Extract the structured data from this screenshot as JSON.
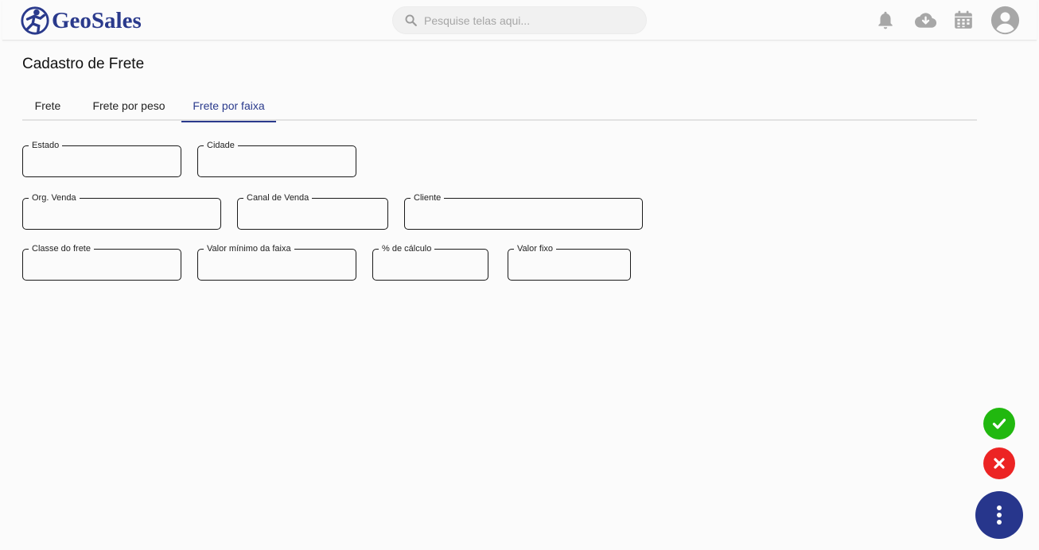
{
  "header": {
    "logo_text": "GeoSales",
    "search_placeholder": "Pesquise telas aqui...",
    "brand_color": "#2a3a8c",
    "icons": [
      "bell-icon",
      "cloud-download-icon",
      "calendar-icon",
      "avatar-icon"
    ]
  },
  "page": {
    "title": "Cadastro de Frete",
    "tabs": [
      {
        "label": "Frete",
        "active": false
      },
      {
        "label": "Frete por peso",
        "active": false
      },
      {
        "label": "Frete por faixa",
        "active": true
      }
    ]
  },
  "form": {
    "estado": {
      "label": "Estado",
      "value": ""
    },
    "cidade": {
      "label": "Cidade",
      "value": ""
    },
    "org_venda": {
      "label": "Org. Venda",
      "value": ""
    },
    "canal_venda": {
      "label": "Canal de Venda",
      "value": ""
    },
    "cliente": {
      "label": "Cliente",
      "value": ""
    },
    "classe_frete": {
      "label": "Classe do frete",
      "value": ""
    },
    "valor_minimo": {
      "label": "Valor mínimo da faixa",
      "value": ""
    },
    "pct_calculo": {
      "label": "% de cálculo",
      "value": ""
    },
    "valor_fixo": {
      "label": "Valor fixo",
      "value": ""
    }
  },
  "actions": {
    "confirm_color": "#21b80f",
    "cancel_color": "#ec2424",
    "menu_color": "#27368c",
    "icons": [
      "check-icon",
      "close-icon",
      "more-vertical-icon"
    ]
  }
}
